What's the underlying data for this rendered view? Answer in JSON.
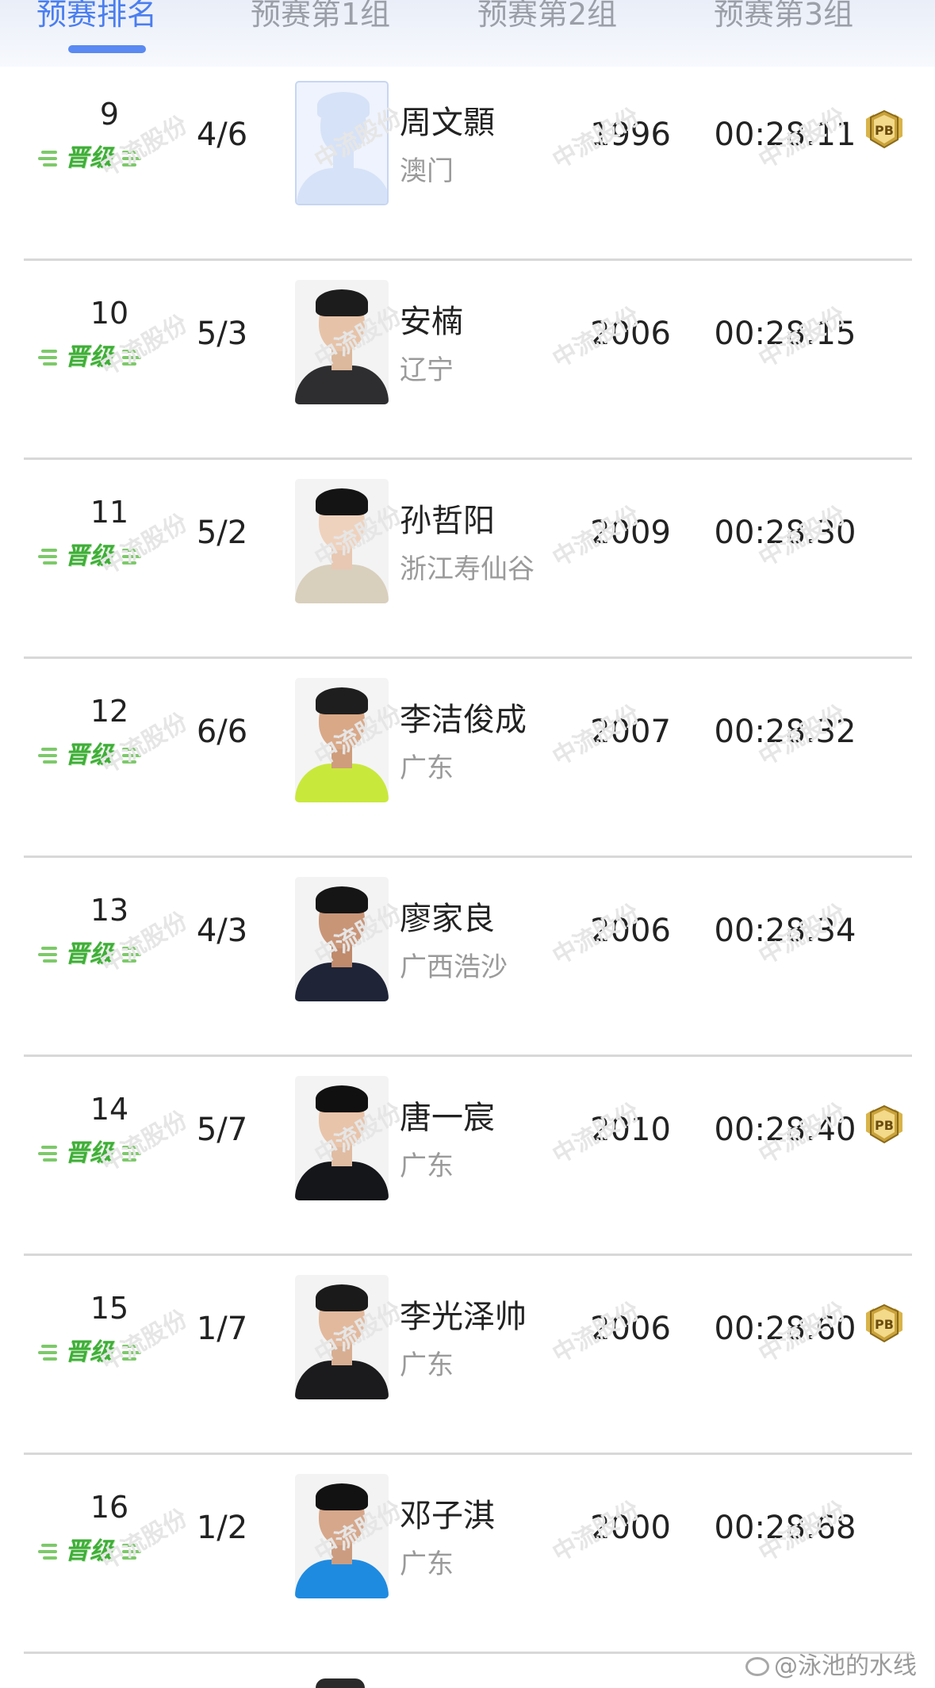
{
  "tabs": [
    {
      "label": "预赛排名",
      "active": true
    },
    {
      "label": "预赛第1组",
      "active": false
    },
    {
      "label": "预赛第2组",
      "active": false
    },
    {
      "label": "预赛第3组",
      "active": false
    }
  ],
  "qualify_label": "晋级",
  "pb_label": "PB",
  "watermark": "中流股份",
  "footer_watermark": "@泳池的水线",
  "rows": [
    {
      "rank": "9",
      "lane": "4/6",
      "name": "周文顥",
      "region": "澳门",
      "year": "1996",
      "time": "00:28.11",
      "pb": true,
      "photo": "placeholder"
    },
    {
      "rank": "10",
      "lane": "5/3",
      "name": "安楠",
      "region": "辽宁",
      "year": "2006",
      "time": "00:28.15",
      "pb": false,
      "photo": "dark-hoodie"
    },
    {
      "rank": "11",
      "lane": "5/2",
      "name": "孙哲阳",
      "region": "浙江寿仙谷",
      "year": "2009",
      "time": "00:28.30",
      "pb": false,
      "photo": "beige-jacket"
    },
    {
      "rank": "12",
      "lane": "6/6",
      "name": "李洁俊成",
      "region": "广东",
      "year": "2007",
      "time": "00:28.32",
      "pb": false,
      "photo": "yellow-shirt"
    },
    {
      "rank": "13",
      "lane": "4/3",
      "name": "廖家良",
      "region": "广西浩沙",
      "year": "2006",
      "time": "00:28.34",
      "pb": false,
      "photo": "dark-shirt"
    },
    {
      "rank": "14",
      "lane": "5/7",
      "name": "唐一宸",
      "region": "广东",
      "year": "2010",
      "time": "00:28.40",
      "pb": true,
      "photo": "black-suit"
    },
    {
      "rank": "15",
      "lane": "1/7",
      "name": "李光泽帅",
      "region": "广东",
      "year": "2006",
      "time": "00:28.60",
      "pb": true,
      "photo": "dark-tee"
    },
    {
      "rank": "16",
      "lane": "1/2",
      "name": "邓子淇",
      "region": "广东",
      "year": "2000",
      "time": "00:28.68",
      "pb": false,
      "photo": "blue-shirt"
    }
  ],
  "colors": {
    "tab_active": "#4a7ef0",
    "tab_inactive": "#9a9fa8",
    "qualify_green": "#3fae38",
    "pb_gold": "#c9a23a",
    "divider": "#d8d8d8"
  }
}
